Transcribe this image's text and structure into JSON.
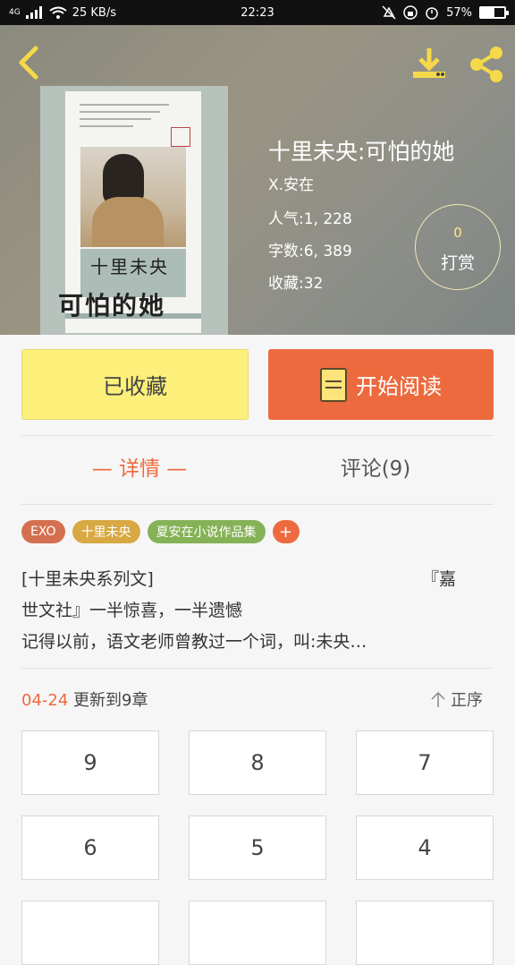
{
  "status_bar": {
    "network": "4G",
    "speed": "25 KB/s",
    "time": "22:23",
    "battery": "57%",
    "battery_level": 0.57
  },
  "book": {
    "title": "十里未央:可怕的她",
    "author": "X.安在",
    "popularity": "人气:1, 228",
    "word_count": "字数:6, 389",
    "favorites": "收藏:32",
    "cover_title_line1": "十里未央",
    "cover_title_line2": "可怕的她"
  },
  "tip": {
    "count": "0",
    "label": "打赏"
  },
  "actions": {
    "collect_label": "已收藏",
    "read_label": "开始阅读"
  },
  "tabs": {
    "detail": "— 详情 —",
    "comments": "评论(9)"
  },
  "tags": [
    {
      "label": "EXO",
      "color": "#d4704f"
    },
    {
      "label": "十里未央",
      "color": "#d8a843"
    },
    {
      "label": "夏安在小说作品集",
      "color": "#86b257"
    }
  ],
  "tag_add": "+",
  "description": {
    "line1a": "[十里未央系列文]",
    "line1b": "『嘉",
    "line2": "世文社』一半惊喜，一半遗憾",
    "line3": "记得以前，语文老师曾教过一个词，叫:未央…"
  },
  "update": {
    "date": "04-24",
    "text": "更新到9章"
  },
  "sort_label": "正序",
  "chapters": [
    "9",
    "8",
    "7",
    "6",
    "5",
    "4"
  ],
  "colors": {
    "accent": "#ed6a3e",
    "collect_bg": "#fcf07a"
  }
}
